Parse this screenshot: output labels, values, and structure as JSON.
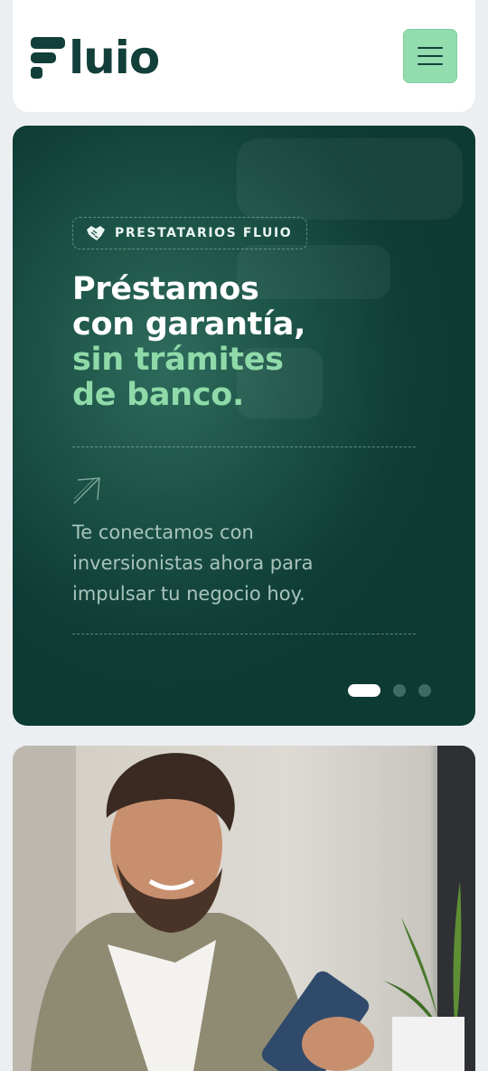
{
  "header": {
    "logo_text": "luio",
    "logo_alt": "Fluio",
    "menu_icon": "hamburger-menu-icon"
  },
  "colors": {
    "brand_dark": "#123f3a",
    "accent_green": "#92dcae",
    "hero_bg": "#0f3e37"
  },
  "hero": {
    "badge": {
      "icon": "handshake-icon",
      "label": "PRESTATARIOS FLUIO"
    },
    "headline": {
      "line1": "Préstamos",
      "line2": "con garantía,",
      "line3": "sin trámites",
      "line4": "de banco."
    },
    "arrow_icon": "arrow-up-right-icon",
    "description": "Te conectamos con inversionistas ahora para impulsar tu negocio hoy.",
    "carousel": {
      "total_slides": 3,
      "active_slide": 1
    }
  },
  "photo": {
    "subject": "Hombre sonriendo mirando su teléfono"
  }
}
